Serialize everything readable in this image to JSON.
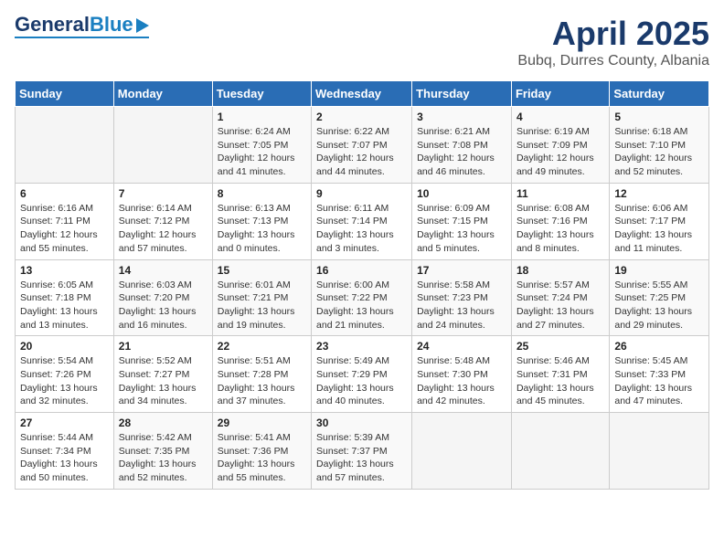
{
  "logo": {
    "general": "General",
    "blue": "Blue"
  },
  "title": "April 2025",
  "subtitle": "Bubq, Durres County, Albania",
  "weekdays": [
    "Sunday",
    "Monday",
    "Tuesday",
    "Wednesday",
    "Thursday",
    "Friday",
    "Saturday"
  ],
  "weeks": [
    [
      null,
      null,
      {
        "day": 1,
        "sunrise": "6:24 AM",
        "sunset": "7:05 PM",
        "daylight": "12 hours and 41 minutes."
      },
      {
        "day": 2,
        "sunrise": "6:22 AM",
        "sunset": "7:07 PM",
        "daylight": "12 hours and 44 minutes."
      },
      {
        "day": 3,
        "sunrise": "6:21 AM",
        "sunset": "7:08 PM",
        "daylight": "12 hours and 46 minutes."
      },
      {
        "day": 4,
        "sunrise": "6:19 AM",
        "sunset": "7:09 PM",
        "daylight": "12 hours and 49 minutes."
      },
      {
        "day": 5,
        "sunrise": "6:18 AM",
        "sunset": "7:10 PM",
        "daylight": "12 hours and 52 minutes."
      }
    ],
    [
      {
        "day": 6,
        "sunrise": "6:16 AM",
        "sunset": "7:11 PM",
        "daylight": "12 hours and 55 minutes."
      },
      {
        "day": 7,
        "sunrise": "6:14 AM",
        "sunset": "7:12 PM",
        "daylight": "12 hours and 57 minutes."
      },
      {
        "day": 8,
        "sunrise": "6:13 AM",
        "sunset": "7:13 PM",
        "daylight": "13 hours and 0 minutes."
      },
      {
        "day": 9,
        "sunrise": "6:11 AM",
        "sunset": "7:14 PM",
        "daylight": "13 hours and 3 minutes."
      },
      {
        "day": 10,
        "sunrise": "6:09 AM",
        "sunset": "7:15 PM",
        "daylight": "13 hours and 5 minutes."
      },
      {
        "day": 11,
        "sunrise": "6:08 AM",
        "sunset": "7:16 PM",
        "daylight": "13 hours and 8 minutes."
      },
      {
        "day": 12,
        "sunrise": "6:06 AM",
        "sunset": "7:17 PM",
        "daylight": "13 hours and 11 minutes."
      }
    ],
    [
      {
        "day": 13,
        "sunrise": "6:05 AM",
        "sunset": "7:18 PM",
        "daylight": "13 hours and 13 minutes."
      },
      {
        "day": 14,
        "sunrise": "6:03 AM",
        "sunset": "7:20 PM",
        "daylight": "13 hours and 16 minutes."
      },
      {
        "day": 15,
        "sunrise": "6:01 AM",
        "sunset": "7:21 PM",
        "daylight": "13 hours and 19 minutes."
      },
      {
        "day": 16,
        "sunrise": "6:00 AM",
        "sunset": "7:22 PM",
        "daylight": "13 hours and 21 minutes."
      },
      {
        "day": 17,
        "sunrise": "5:58 AM",
        "sunset": "7:23 PM",
        "daylight": "13 hours and 24 minutes."
      },
      {
        "day": 18,
        "sunrise": "5:57 AM",
        "sunset": "7:24 PM",
        "daylight": "13 hours and 27 minutes."
      },
      {
        "day": 19,
        "sunrise": "5:55 AM",
        "sunset": "7:25 PM",
        "daylight": "13 hours and 29 minutes."
      }
    ],
    [
      {
        "day": 20,
        "sunrise": "5:54 AM",
        "sunset": "7:26 PM",
        "daylight": "13 hours and 32 minutes."
      },
      {
        "day": 21,
        "sunrise": "5:52 AM",
        "sunset": "7:27 PM",
        "daylight": "13 hours and 34 minutes."
      },
      {
        "day": 22,
        "sunrise": "5:51 AM",
        "sunset": "7:28 PM",
        "daylight": "13 hours and 37 minutes."
      },
      {
        "day": 23,
        "sunrise": "5:49 AM",
        "sunset": "7:29 PM",
        "daylight": "13 hours and 40 minutes."
      },
      {
        "day": 24,
        "sunrise": "5:48 AM",
        "sunset": "7:30 PM",
        "daylight": "13 hours and 42 minutes."
      },
      {
        "day": 25,
        "sunrise": "5:46 AM",
        "sunset": "7:31 PM",
        "daylight": "13 hours and 45 minutes."
      },
      {
        "day": 26,
        "sunrise": "5:45 AM",
        "sunset": "7:33 PM",
        "daylight": "13 hours and 47 minutes."
      }
    ],
    [
      {
        "day": 27,
        "sunrise": "5:44 AM",
        "sunset": "7:34 PM",
        "daylight": "13 hours and 50 minutes."
      },
      {
        "day": 28,
        "sunrise": "5:42 AM",
        "sunset": "7:35 PM",
        "daylight": "13 hours and 52 minutes."
      },
      {
        "day": 29,
        "sunrise": "5:41 AM",
        "sunset": "7:36 PM",
        "daylight": "13 hours and 55 minutes."
      },
      {
        "day": 30,
        "sunrise": "5:39 AM",
        "sunset": "7:37 PM",
        "daylight": "13 hours and 57 minutes."
      },
      null,
      null,
      null
    ]
  ]
}
